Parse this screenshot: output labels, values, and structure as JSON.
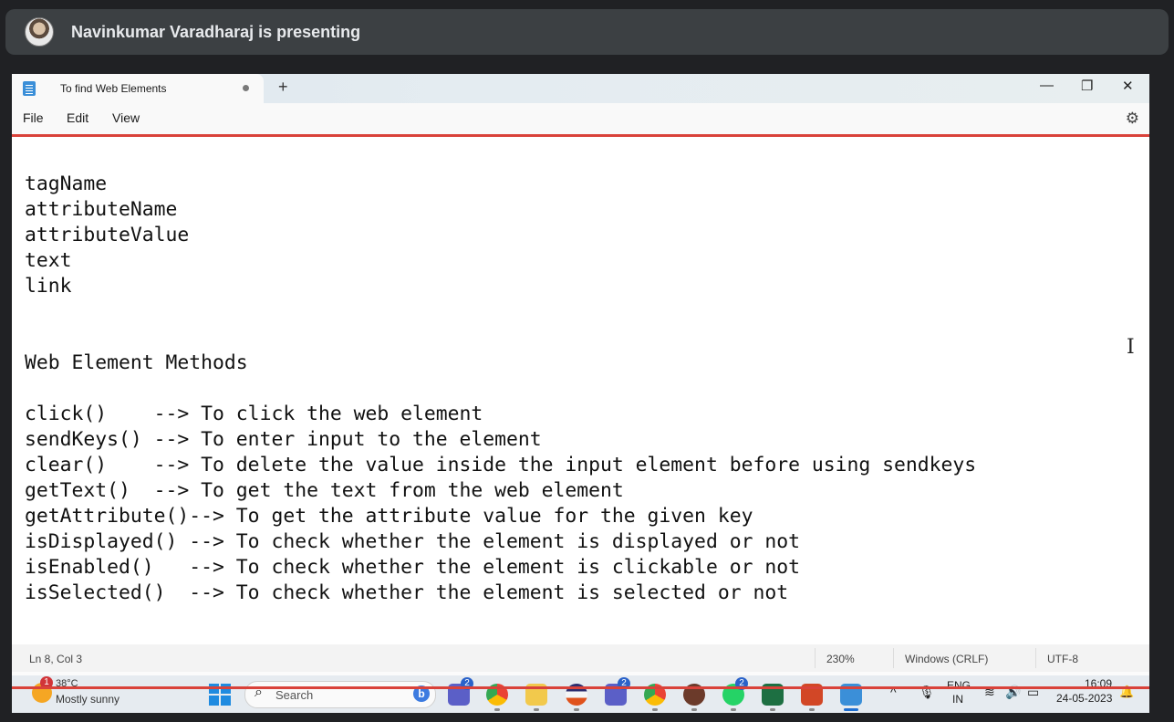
{
  "presenter": {
    "text": "Navinkumar Varadharaj is presenting"
  },
  "window": {
    "tab_title": "To find Web Elements",
    "new_tab": "+",
    "minimize": "—",
    "maximize": "❐",
    "close": "✕"
  },
  "menu": {
    "file": "File",
    "edit": "Edit",
    "view": "View"
  },
  "editor": {
    "lines": [
      "tagName",
      "attributeName",
      "attributeValue",
      "text",
      "link",
      "",
      "",
      "Web Element Methods",
      "",
      "click()    --> To click the web element",
      "sendKeys() --> To enter input to the element",
      "clear()    --> To delete the value inside the input element before using sendkeys",
      "getText()  --> To get the text from the web element",
      "getAttribute()--> To get the attribute value for the given key",
      "isDisplayed() --> To check whether the element is displayed or not",
      "isEnabled()   --> To check whether the element is clickable or not",
      "isSelected()  --> To check whether the element is selected or not"
    ]
  },
  "status": {
    "position": "Ln 8, Col 3",
    "zoom": "230%",
    "line_ending": "Windows (CRLF)",
    "encoding": "UTF-8"
  },
  "taskbar": {
    "weather_badge": "1",
    "weather_temp": "38°C",
    "weather_desc": "Mostly sunny",
    "search_placeholder": "Search",
    "bing_label": "b",
    "badge_teams": "2",
    "badge_teams2": "2",
    "badge_whatsapp": "2",
    "lang_line1": "ENG",
    "lang_line2": "IN",
    "time": "16:09",
    "date": "24-05-2023"
  },
  "icons": {
    "app_icon": "notepad-icon",
    "settings": "gear-icon",
    "cursor": "text-cursor-icon"
  },
  "colors": {
    "accent_red": "#d9423a",
    "presenter_bar": "#3c4043",
    "windows_blue": "#1f8be0"
  }
}
